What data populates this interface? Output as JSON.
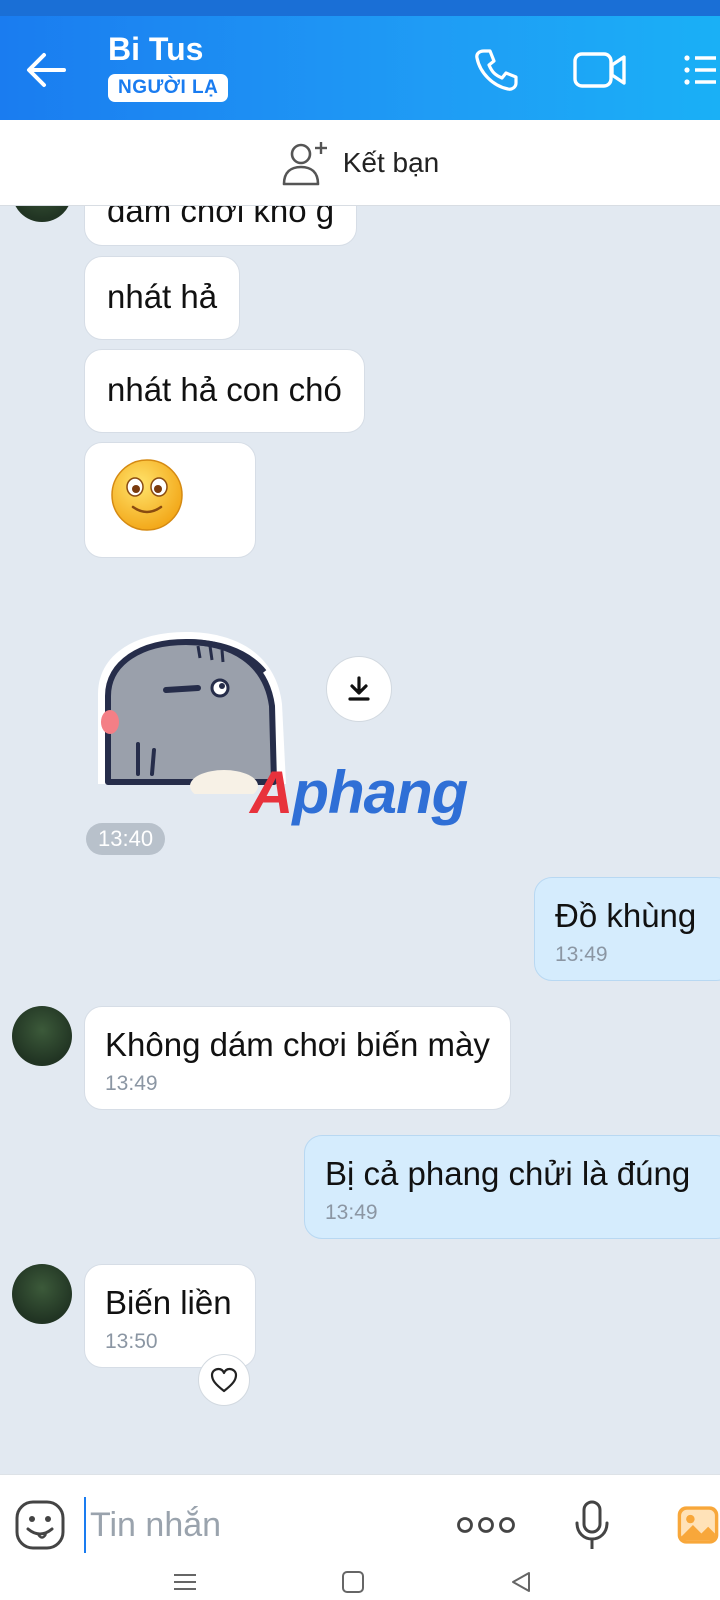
{
  "header": {
    "contact_name": "Bi Tus",
    "stranger_badge": "NGƯỜI LẠ",
    "icons": [
      "back-arrow-icon",
      "phone-icon",
      "video-call-icon",
      "menu-list-icon"
    ]
  },
  "friend_bar": {
    "label": "Kết bạn",
    "icon": "add-person-icon"
  },
  "messages": [
    {
      "id": "m1",
      "side": "other",
      "text": "dám  chơi khô g",
      "time": ""
    },
    {
      "id": "m2",
      "side": "other",
      "text": "nhát hả",
      "time": ""
    },
    {
      "id": "m3",
      "side": "other",
      "text": "nhát hả con chó",
      "time": ""
    },
    {
      "id": "m4",
      "side": "other",
      "type": "emoji",
      "icon": "smile-emoji-icon",
      "time": ""
    },
    {
      "id": "m5",
      "side": "other",
      "type": "sticker",
      "icon": "seal-sticker-icon",
      "time": "13:40"
    },
    {
      "id": "m6",
      "side": "me",
      "text": "Đồ khùng",
      "time": "13:49"
    },
    {
      "id": "m7",
      "side": "other",
      "text": "Không dám chơi biến mày",
      "time": "13:49"
    },
    {
      "id": "m8",
      "side": "me",
      "text": "Bị cả phang chửi là đúng",
      "time": "13:49"
    },
    {
      "id": "m9",
      "side": "other",
      "text": "Biến liền",
      "time": "13:50"
    }
  ],
  "watermark": {
    "first": "A",
    "rest": "phang"
  },
  "composer": {
    "placeholder": "Tin nhắn",
    "icons": [
      "emoji-face-icon",
      "more-dots-icon",
      "microphone-icon",
      "image-icon"
    ]
  },
  "nav": [
    "recent-apps-icon",
    "home-icon",
    "back-icon"
  ],
  "colors": {
    "accent": "#1a7cf0",
    "me_bubble": "#d5ecfd",
    "chat_bg": "#e2e9f1"
  }
}
